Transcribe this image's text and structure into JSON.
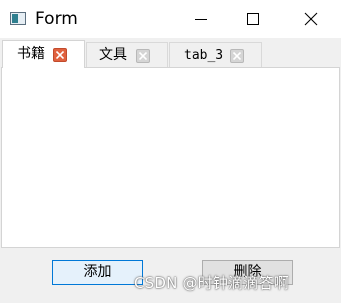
{
  "window": {
    "title": "Form",
    "controls": {
      "minimize_icon": "minimize-icon",
      "maximize_icon": "maximize-icon",
      "close_icon": "close-icon"
    }
  },
  "tabs": [
    {
      "label": "书籍",
      "active": true,
      "close_icon": "close-icon",
      "close_color": "#e0613f"
    },
    {
      "label": "文具",
      "active": false,
      "close_icon": "close-icon",
      "close_color": "#d5d5d5"
    },
    {
      "label": "tab_3",
      "active": false,
      "close_icon": "close-icon",
      "close_color": "#d5d5d5"
    }
  ],
  "buttons": {
    "add_label": "添加",
    "delete_label": "删除"
  },
  "watermark": "CSDN @时钟滴滴答啊",
  "colors": {
    "focus_border": "#0078d7",
    "active_tab_close": "#e0613f"
  }
}
